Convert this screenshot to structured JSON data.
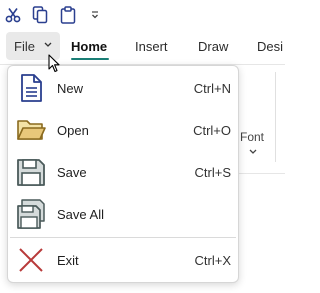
{
  "quick_access": {
    "items": [
      {
        "icon": "scissors-icon"
      },
      {
        "icon": "copy-icon"
      },
      {
        "icon": "clipboard-icon"
      },
      {
        "icon": "customize-chevron-icon"
      }
    ]
  },
  "ribbon": {
    "file_label": "File",
    "tabs": [
      {
        "label": "Home",
        "active": true
      },
      {
        "label": "Insert"
      },
      {
        "label": "Draw"
      },
      {
        "label": "Desi"
      }
    ],
    "font_group_label": "Font",
    "accent_color": "#1a7f76"
  },
  "file_menu": {
    "items": [
      {
        "label": "New",
        "shortcut": "Ctrl+N",
        "icon": "new-document-icon"
      },
      {
        "label": "Open",
        "shortcut": "Ctrl+O",
        "icon": "folder-open-icon"
      },
      {
        "label": "Save",
        "shortcut": "Ctrl+S",
        "icon": "floppy-disk-icon"
      },
      {
        "label": "Save All",
        "shortcut": "",
        "icon": "save-all-icon"
      },
      {
        "label": "Exit",
        "shortcut": "Ctrl+X",
        "icon": "close-x-icon"
      }
    ]
  }
}
